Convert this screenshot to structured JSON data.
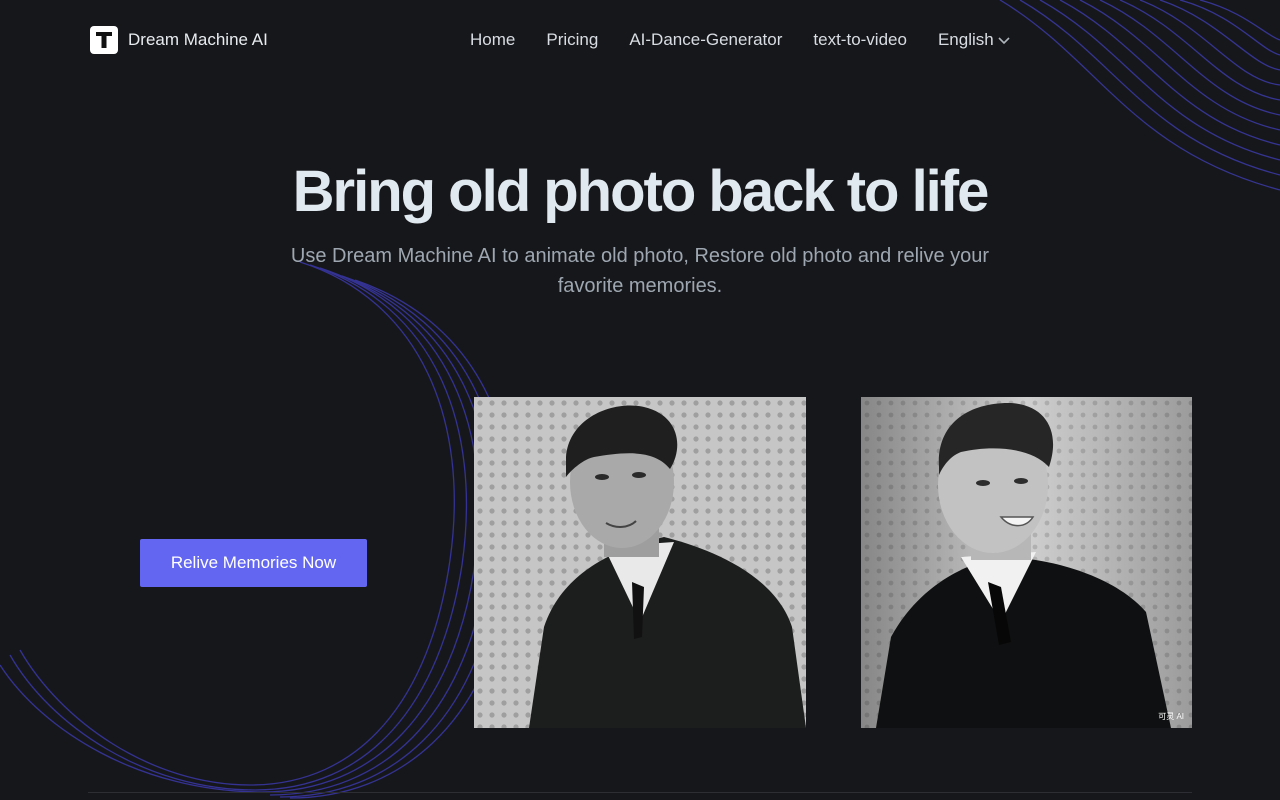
{
  "header": {
    "brand": "Dream Machine AI",
    "logo_letter": "T",
    "nav": [
      {
        "label": "Home"
      },
      {
        "label": "Pricing"
      },
      {
        "label": "AI-Dance-Generator"
      },
      {
        "label": "text-to-video"
      }
    ],
    "language": "English"
  },
  "hero": {
    "title": "Bring old photo back to life",
    "subtitle": "Use Dream Machine AI to animate old photo, Restore old photo and relive your favorite memories.",
    "cta_label": "Relive Memories Now"
  },
  "photos": {
    "before_alt": "Old black and white photo of a man in a suit",
    "after_alt": "Restored photo of the same man smiling",
    "watermark": "可灵 AI"
  },
  "colors": {
    "background": "#16171a",
    "accent": "#6366f1",
    "decor_lines": "#3b3aa8"
  }
}
